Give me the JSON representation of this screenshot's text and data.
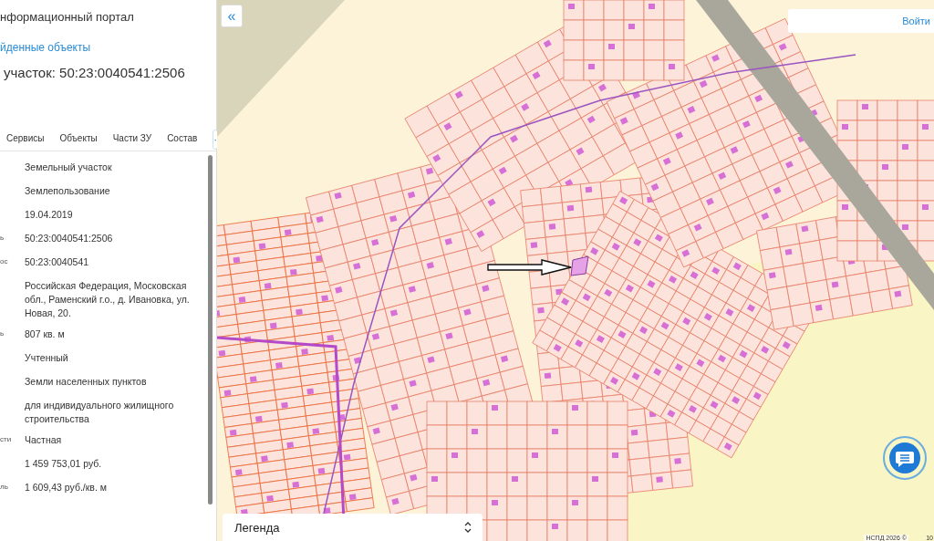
{
  "panel": {
    "portal_title": "нформационный портал",
    "breadcrumb": "йденные объекты",
    "heading": "участок: 50:23:0040541:2506",
    "tabs": [
      {
        "label": "Сервисы",
        "selected": false
      },
      {
        "label": "Объекты",
        "selected": false
      },
      {
        "label": "Части ЗУ",
        "selected": false
      },
      {
        "label": "Состав",
        "selected": false
      }
    ],
    "tabs_more": "·",
    "attributes": [
      {
        "value": "Земельный участок"
      },
      {
        "value": "Землепользование"
      },
      {
        "value": "19.04.2019"
      },
      {
        "label": "ь",
        "value": "50:23:0040541:2506"
      },
      {
        "label": "ос",
        "value": "50:23:0040541"
      },
      {
        "value": "Российская Федерация, Московская обл., Раменский г.о., д. Ивановка, ул. Новая, 20."
      },
      {
        "label": "ь",
        "value": "807 кв. м"
      },
      {
        "value": "Учтенный"
      },
      {
        "value": "Земли населенных пунктов"
      },
      {
        "value": "для индивидуального жилищного строительства"
      },
      {
        "label": "сти",
        "value": "Частная"
      },
      {
        "value": "1 459 753,01 руб."
      },
      {
        "label": "ль",
        "value": "1 609,43 руб./кв. м"
      }
    ]
  },
  "map": {
    "collapse_button": "«",
    "login_button": "Войти",
    "legend": "Легенда",
    "attribution": "НСПД 2026 ©",
    "scale": "10"
  }
}
